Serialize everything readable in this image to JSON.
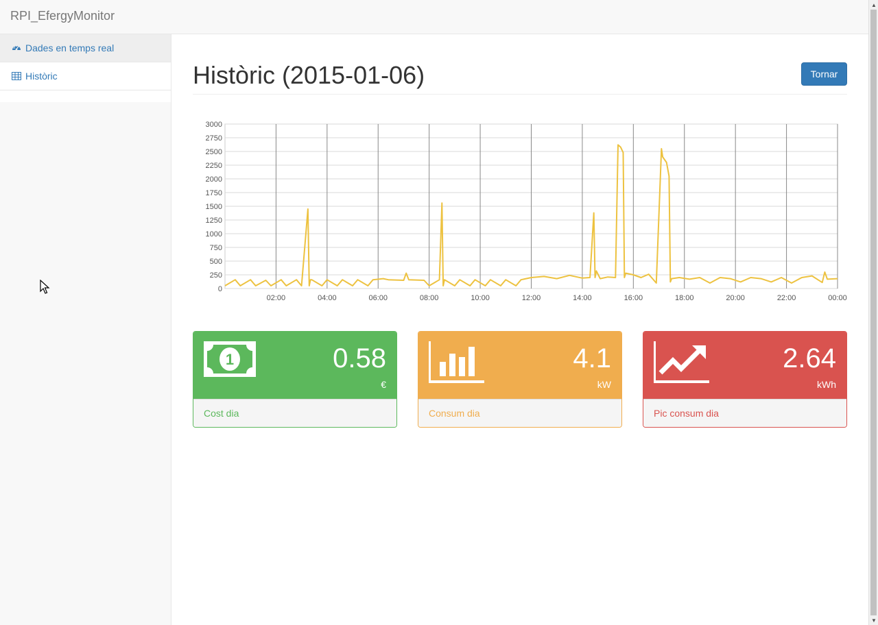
{
  "app": {
    "brand": "RPI_EfergyMonitor"
  },
  "sidebar": {
    "items": [
      {
        "label": "Dades en temps real",
        "icon": "dashboard-icon"
      },
      {
        "label": "Històric",
        "icon": "table-icon"
      }
    ]
  },
  "header": {
    "title": "Històric (2015-01-06)",
    "back_label": "Tornar"
  },
  "panels": {
    "cost": {
      "value": "0.58",
      "unit": "€",
      "label": "Cost dia",
      "icon": "money-icon",
      "color": "#5cb85c"
    },
    "consum": {
      "value": "4.1",
      "unit": "kW",
      "label": "Consum dia",
      "icon": "bar-chart-icon",
      "color": "#f0ad4e"
    },
    "pic": {
      "value": "2.64",
      "unit": "kWh",
      "label": "Pic consum dia",
      "icon": "trend-up-icon",
      "color": "#d9534f"
    }
  },
  "chart_data": {
    "type": "line",
    "title": "",
    "xlabel": "",
    "ylabel": "",
    "ylim": [
      0,
      3000
    ],
    "xlim": [
      0,
      24
    ],
    "grid": true,
    "y_ticks": [
      "0",
      "250",
      "500",
      "750",
      "1000",
      "1250",
      "1500",
      "1750",
      "2000",
      "2250",
      "2500",
      "2750",
      "3000"
    ],
    "x_ticks": [
      "02:00",
      "04:00",
      "06:00",
      "08:00",
      "10:00",
      "12:00",
      "14:00",
      "16:00",
      "18:00",
      "20:00",
      "22:00",
      "00:00"
    ],
    "line_color": "#edc240",
    "series": [
      {
        "x": [
          0.0,
          0.4,
          0.6,
          1.0,
          1.2,
          1.6,
          1.8,
          2.2,
          2.4,
          2.8,
          3.0,
          3.25,
          3.3,
          3.35,
          3.4,
          3.8,
          4.0,
          4.4,
          4.6,
          5.0,
          5.2,
          5.6,
          5.8,
          6.2,
          6.4,
          7.0,
          7.1,
          7.2,
          7.8,
          8.0,
          8.4,
          8.5,
          8.55,
          8.6,
          9.0,
          9.2,
          9.6,
          9.8,
          10.2,
          10.4,
          10.8,
          11.0,
          11.4,
          11.6,
          12.0,
          12.5,
          13.0,
          13.5,
          14.0,
          14.3,
          14.45,
          14.5,
          14.55,
          14.7,
          15.0,
          15.3,
          15.4,
          15.5,
          15.6,
          15.65,
          15.7,
          16.0,
          16.3,
          16.6,
          16.9,
          17.1,
          17.15,
          17.3,
          17.4,
          17.45,
          17.5,
          17.8,
          18.2,
          18.6,
          19.0,
          19.4,
          19.8,
          20.2,
          20.6,
          21.0,
          21.4,
          21.8,
          22.2,
          22.6,
          23.0,
          23.4,
          23.5,
          23.6,
          24.0
        ],
        "y": [
          50,
          160,
          50,
          160,
          50,
          150,
          50,
          160,
          50,
          160,
          50,
          1450,
          50,
          160,
          160,
          50,
          160,
          50,
          160,
          50,
          160,
          50,
          160,
          180,
          160,
          150,
          280,
          160,
          150,
          50,
          160,
          1560,
          50,
          160,
          50,
          160,
          50,
          160,
          50,
          160,
          50,
          160,
          50,
          160,
          200,
          220,
          180,
          240,
          190,
          200,
          1380,
          200,
          320,
          180,
          210,
          200,
          2620,
          2580,
          2480,
          200,
          280,
          250,
          200,
          260,
          100,
          2550,
          2400,
          2300,
          2050,
          120,
          180,
          200,
          170,
          200,
          100,
          200,
          180,
          120,
          200,
          180,
          120,
          200,
          100,
          200,
          230,
          110,
          300,
          170,
          180
        ]
      }
    ]
  }
}
